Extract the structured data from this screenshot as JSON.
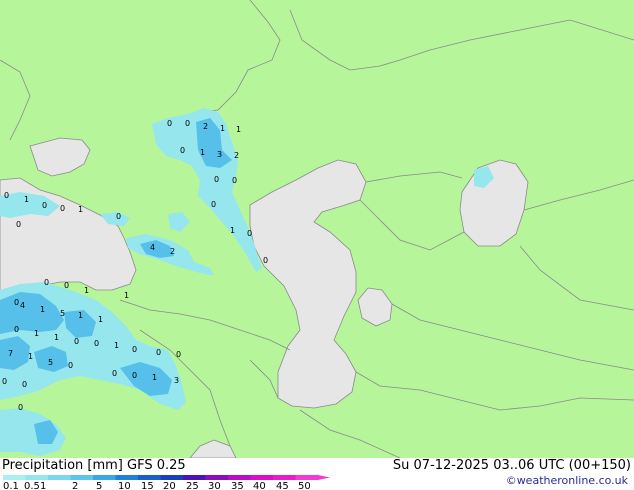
{
  "footer": {
    "title": "Precipitation [mm]  GFS 0.25",
    "valid_time": "Su 07-12-2025 03..06 UTC (00+150)",
    "credit": "©weatheronline.co.uk"
  },
  "legend": {
    "ticks": [
      "0.1",
      "0.5",
      "1",
      "2",
      "5",
      "10",
      "15",
      "20",
      "25",
      "30",
      "35",
      "40",
      "45",
      "50"
    ],
    "colors": [
      "#aaf0f0",
      "#96e6ee",
      "#7ad7ee",
      "#5ec4ea",
      "#3aa8e2",
      "#1f82d4",
      "#1a5fc8",
      "#1a3fb8",
      "#4a14b4",
      "#8a10bc",
      "#b80ec4",
      "#d80ec8",
      "#e81cc8",
      "#f03cd4"
    ]
  },
  "colors": {
    "land": "#b6f59a",
    "sea": "#e6e6e6",
    "border": "#8a8a8a",
    "precip_light": "#96e6ee",
    "precip_medium": "#56c0ea"
  },
  "precip_values": [
    "0",
    "0",
    "2",
    "1",
    "1",
    "0",
    "1",
    "3",
    "2",
    "0",
    "0",
    "0",
    "1",
    "0",
    "0",
    "0",
    "1",
    "0",
    "0",
    "1",
    "0",
    "0",
    "4",
    "2",
    "1",
    "0",
    "0",
    "1",
    "0",
    "4",
    "1",
    "5",
    "1",
    "1",
    "0",
    "1",
    "1",
    "0",
    "7",
    "1",
    "5",
    "0",
    "0",
    "1",
    "0",
    "0",
    "0",
    "0",
    "0",
    "1",
    "3",
    "0",
    "0",
    "0"
  ]
}
